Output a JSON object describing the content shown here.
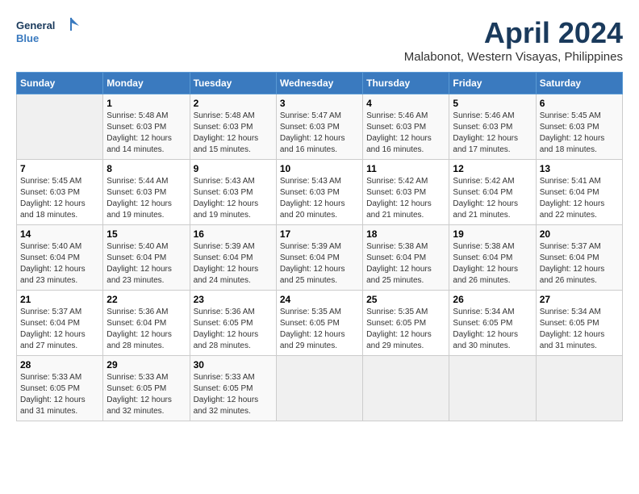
{
  "logo": {
    "line1": "General",
    "line2": "Blue"
  },
  "title": "April 2024",
  "subtitle": "Malabonot, Western Visayas, Philippines",
  "headers": [
    "Sunday",
    "Monday",
    "Tuesday",
    "Wednesday",
    "Thursday",
    "Friday",
    "Saturday"
  ],
  "weeks": [
    [
      {
        "day": "",
        "info": ""
      },
      {
        "day": "1",
        "info": "Sunrise: 5:48 AM\nSunset: 6:03 PM\nDaylight: 12 hours\nand 14 minutes."
      },
      {
        "day": "2",
        "info": "Sunrise: 5:48 AM\nSunset: 6:03 PM\nDaylight: 12 hours\nand 15 minutes."
      },
      {
        "day": "3",
        "info": "Sunrise: 5:47 AM\nSunset: 6:03 PM\nDaylight: 12 hours\nand 16 minutes."
      },
      {
        "day": "4",
        "info": "Sunrise: 5:46 AM\nSunset: 6:03 PM\nDaylight: 12 hours\nand 16 minutes."
      },
      {
        "day": "5",
        "info": "Sunrise: 5:46 AM\nSunset: 6:03 PM\nDaylight: 12 hours\nand 17 minutes."
      },
      {
        "day": "6",
        "info": "Sunrise: 5:45 AM\nSunset: 6:03 PM\nDaylight: 12 hours\nand 18 minutes."
      }
    ],
    [
      {
        "day": "7",
        "info": "Sunrise: 5:45 AM\nSunset: 6:03 PM\nDaylight: 12 hours\nand 18 minutes."
      },
      {
        "day": "8",
        "info": "Sunrise: 5:44 AM\nSunset: 6:03 PM\nDaylight: 12 hours\nand 19 minutes."
      },
      {
        "day": "9",
        "info": "Sunrise: 5:43 AM\nSunset: 6:03 PM\nDaylight: 12 hours\nand 19 minutes."
      },
      {
        "day": "10",
        "info": "Sunrise: 5:43 AM\nSunset: 6:03 PM\nDaylight: 12 hours\nand 20 minutes."
      },
      {
        "day": "11",
        "info": "Sunrise: 5:42 AM\nSunset: 6:03 PM\nDaylight: 12 hours\nand 21 minutes."
      },
      {
        "day": "12",
        "info": "Sunrise: 5:42 AM\nSunset: 6:04 PM\nDaylight: 12 hours\nand 21 minutes."
      },
      {
        "day": "13",
        "info": "Sunrise: 5:41 AM\nSunset: 6:04 PM\nDaylight: 12 hours\nand 22 minutes."
      }
    ],
    [
      {
        "day": "14",
        "info": "Sunrise: 5:40 AM\nSunset: 6:04 PM\nDaylight: 12 hours\nand 23 minutes."
      },
      {
        "day": "15",
        "info": "Sunrise: 5:40 AM\nSunset: 6:04 PM\nDaylight: 12 hours\nand 23 minutes."
      },
      {
        "day": "16",
        "info": "Sunrise: 5:39 AM\nSunset: 6:04 PM\nDaylight: 12 hours\nand 24 minutes."
      },
      {
        "day": "17",
        "info": "Sunrise: 5:39 AM\nSunset: 6:04 PM\nDaylight: 12 hours\nand 25 minutes."
      },
      {
        "day": "18",
        "info": "Sunrise: 5:38 AM\nSunset: 6:04 PM\nDaylight: 12 hours\nand 25 minutes."
      },
      {
        "day": "19",
        "info": "Sunrise: 5:38 AM\nSunset: 6:04 PM\nDaylight: 12 hours\nand 26 minutes."
      },
      {
        "day": "20",
        "info": "Sunrise: 5:37 AM\nSunset: 6:04 PM\nDaylight: 12 hours\nand 26 minutes."
      }
    ],
    [
      {
        "day": "21",
        "info": "Sunrise: 5:37 AM\nSunset: 6:04 PM\nDaylight: 12 hours\nand 27 minutes."
      },
      {
        "day": "22",
        "info": "Sunrise: 5:36 AM\nSunset: 6:04 PM\nDaylight: 12 hours\nand 28 minutes."
      },
      {
        "day": "23",
        "info": "Sunrise: 5:36 AM\nSunset: 6:05 PM\nDaylight: 12 hours\nand 28 minutes."
      },
      {
        "day": "24",
        "info": "Sunrise: 5:35 AM\nSunset: 6:05 PM\nDaylight: 12 hours\nand 29 minutes."
      },
      {
        "day": "25",
        "info": "Sunrise: 5:35 AM\nSunset: 6:05 PM\nDaylight: 12 hours\nand 29 minutes."
      },
      {
        "day": "26",
        "info": "Sunrise: 5:34 AM\nSunset: 6:05 PM\nDaylight: 12 hours\nand 30 minutes."
      },
      {
        "day": "27",
        "info": "Sunrise: 5:34 AM\nSunset: 6:05 PM\nDaylight: 12 hours\nand 31 minutes."
      }
    ],
    [
      {
        "day": "28",
        "info": "Sunrise: 5:33 AM\nSunset: 6:05 PM\nDaylight: 12 hours\nand 31 minutes."
      },
      {
        "day": "29",
        "info": "Sunrise: 5:33 AM\nSunset: 6:05 PM\nDaylight: 12 hours\nand 32 minutes."
      },
      {
        "day": "30",
        "info": "Sunrise: 5:33 AM\nSunset: 6:05 PM\nDaylight: 12 hours\nand 32 minutes."
      },
      {
        "day": "",
        "info": ""
      },
      {
        "day": "",
        "info": ""
      },
      {
        "day": "",
        "info": ""
      },
      {
        "day": "",
        "info": ""
      }
    ]
  ]
}
